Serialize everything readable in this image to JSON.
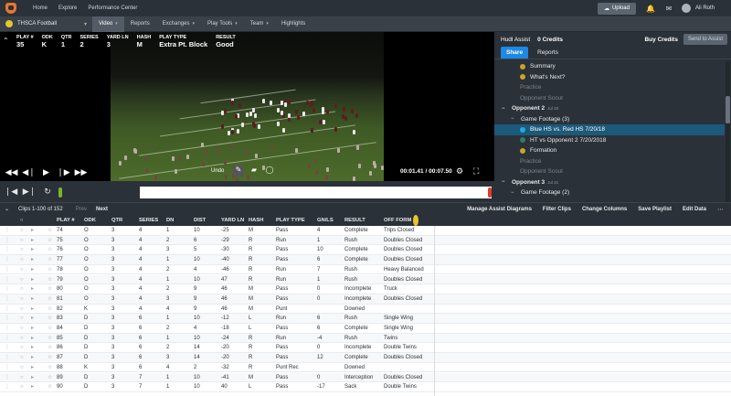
{
  "topbar": {
    "nav": [
      "Home",
      "Explore",
      "Performance Center"
    ],
    "upload_label": "Upload",
    "user_name": "Ali Roth"
  },
  "secbar": {
    "team": "THSCA Football",
    "nav": [
      {
        "label": "Video",
        "chevron": true,
        "active": true
      },
      {
        "label": "Reports",
        "chevron": false,
        "active": false
      },
      {
        "label": "Exchanges",
        "chevron": true,
        "active": false
      },
      {
        "label": "Play Tools",
        "chevron": true,
        "active": false
      },
      {
        "label": "Team",
        "chevron": true,
        "active": false
      },
      {
        "label": "Highlights",
        "chevron": false,
        "active": false
      }
    ]
  },
  "play_info": [
    {
      "h": "PLAY #",
      "v": "35"
    },
    {
      "h": "ODK",
      "v": "K"
    },
    {
      "h": "QTR",
      "v": "1"
    },
    {
      "h": "SERIES",
      "v": "2"
    },
    {
      "h": "YARD LN",
      "v": "3"
    },
    {
      "h": "HASH",
      "v": "M"
    },
    {
      "h": "PLAY TYPE",
      "v": "Extra Pt. Block"
    },
    {
      "h": "RESULT",
      "v": "Good"
    }
  ],
  "video": {
    "undo_label": "Undo",
    "timecode": "00:01.41 / 00:07.50"
  },
  "side": {
    "title": "Hudl Assist",
    "credits": "0 Credits",
    "buy_label": "Buy Credits",
    "send_label": "Send to Assist",
    "tabs": [
      "Share",
      "Reports"
    ],
    "tree": [
      {
        "label": "Summary",
        "level": 2,
        "dot": "#c9a227",
        "style": ""
      },
      {
        "label": "What's Next?",
        "level": 2,
        "dot": "#c9a227",
        "style": ""
      },
      {
        "label": "Practice",
        "level": 2,
        "dot": "",
        "style": "muted"
      },
      {
        "label": "Opponent Scout",
        "level": 2,
        "dot": "",
        "style": "muted"
      },
      {
        "label": "Opponent 2",
        "date": "Jul 20",
        "level": 0,
        "exp": "−",
        "style": "bold"
      },
      {
        "label": "Game Footage (3)",
        "level": 1,
        "exp": "−",
        "style": ""
      },
      {
        "label": "Blue HS vs. Red HS 7/20/18",
        "level": 2,
        "dot": "#29a8e0",
        "style": "sel"
      },
      {
        "label": "HT vs Opponent 2 7/20/2018",
        "level": 2,
        "dot": "#2f7f5f",
        "style": ""
      },
      {
        "label": "Formation",
        "level": 2,
        "dot": "#c9a227",
        "style": ""
      },
      {
        "label": "Practice",
        "level": 2,
        "dot": "",
        "style": "muted"
      },
      {
        "label": "Opponent Scout",
        "level": 2,
        "dot": "",
        "style": "muted"
      },
      {
        "label": "Opponent 3",
        "date": "Jul 21",
        "level": 0,
        "exp": "−",
        "style": "bold"
      },
      {
        "label": "Game Footage (2)",
        "level": 1,
        "exp": "−",
        "style": ""
      }
    ]
  },
  "clipbar": {
    "clips_label": "Clips 1-100 of 152",
    "prev_label": "Prev",
    "next_label": "Next",
    "actions": [
      "Manage Assist Diagrams",
      "Filter Clips",
      "Change Columns",
      "Save Playlist",
      "Edit Data"
    ]
  },
  "grid": {
    "columns": [
      "PLAY #",
      "ODK",
      "QTR",
      "SERIES",
      "DN",
      "DIST",
      "YARD LN",
      "HASH",
      "PLAY TYPE",
      "GN/LS",
      "RESULT",
      "OFF FORM"
    ],
    "rows": [
      [
        "74",
        "O",
        "3",
        "4",
        "1",
        "10",
        "-25",
        "M",
        "Pass",
        "4",
        "Complete",
        "Trips Closed"
      ],
      [
        "75",
        "O",
        "3",
        "4",
        "2",
        "6",
        "-29",
        "R",
        "Run",
        "1",
        "Rush",
        "Doubles Closed"
      ],
      [
        "76",
        "O",
        "3",
        "4",
        "3",
        "5",
        "-30",
        "R",
        "Pass",
        "10",
        "Complete",
        "Doubles Closed"
      ],
      [
        "77",
        "O",
        "3",
        "4",
        "1",
        "10",
        "-40",
        "R",
        "Pass",
        "6",
        "Complete",
        "Doubles Closed"
      ],
      [
        "78",
        "O",
        "3",
        "4",
        "2",
        "4",
        "-46",
        "R",
        "Run",
        "7",
        "Rush",
        "Heavy Balanced"
      ],
      [
        "79",
        "O",
        "3",
        "4",
        "1",
        "10",
        "47",
        "R",
        "Run",
        "1",
        "Rush",
        "Doubles Closed"
      ],
      [
        "80",
        "O",
        "3",
        "4",
        "2",
        "9",
        "46",
        "M",
        "Pass",
        "0",
        "Incomplete",
        "Truck"
      ],
      [
        "81",
        "O",
        "3",
        "4",
        "3",
        "9",
        "46",
        "M",
        "Pass",
        "0",
        "Incomplete",
        "Doubles Closed"
      ],
      [
        "82",
        "K",
        "3",
        "4",
        "4",
        "9",
        "46",
        "M",
        "Punt",
        "",
        "Downed",
        ""
      ],
      [
        "83",
        "D",
        "3",
        "6",
        "1",
        "10",
        "-12",
        "L",
        "Run",
        "6",
        "Rush",
        "Single Wing"
      ],
      [
        "84",
        "D",
        "3",
        "6",
        "2",
        "4",
        "-18",
        "L",
        "Pass",
        "6",
        "Complete",
        "Single Wing"
      ],
      [
        "85",
        "D",
        "3",
        "6",
        "1",
        "10",
        "-24",
        "R",
        "Run",
        "-4",
        "Rush",
        "Twins"
      ],
      [
        "86",
        "D",
        "3",
        "6",
        "2",
        "14",
        "-20",
        "R",
        "Pass",
        "0",
        "Incomplete",
        "Double Twins"
      ],
      [
        "87",
        "D",
        "3",
        "6",
        "3",
        "14",
        "-20",
        "R",
        "Pass",
        "12",
        "Complete",
        "Doubles Closed"
      ],
      [
        "88",
        "K",
        "3",
        "6",
        "4",
        "2",
        "-32",
        "R",
        "Punt Rec",
        "",
        "Downed",
        ""
      ],
      [
        "89",
        "D",
        "3",
        "7",
        "1",
        "10",
        "-41",
        "M",
        "Pass",
        "0",
        "Interception",
        "Doubles Closed"
      ],
      [
        "90",
        "D",
        "3",
        "7",
        "1",
        "10",
        "40",
        "L",
        "Pass",
        "-17",
        "Sack",
        "Double Twins"
      ]
    ]
  }
}
